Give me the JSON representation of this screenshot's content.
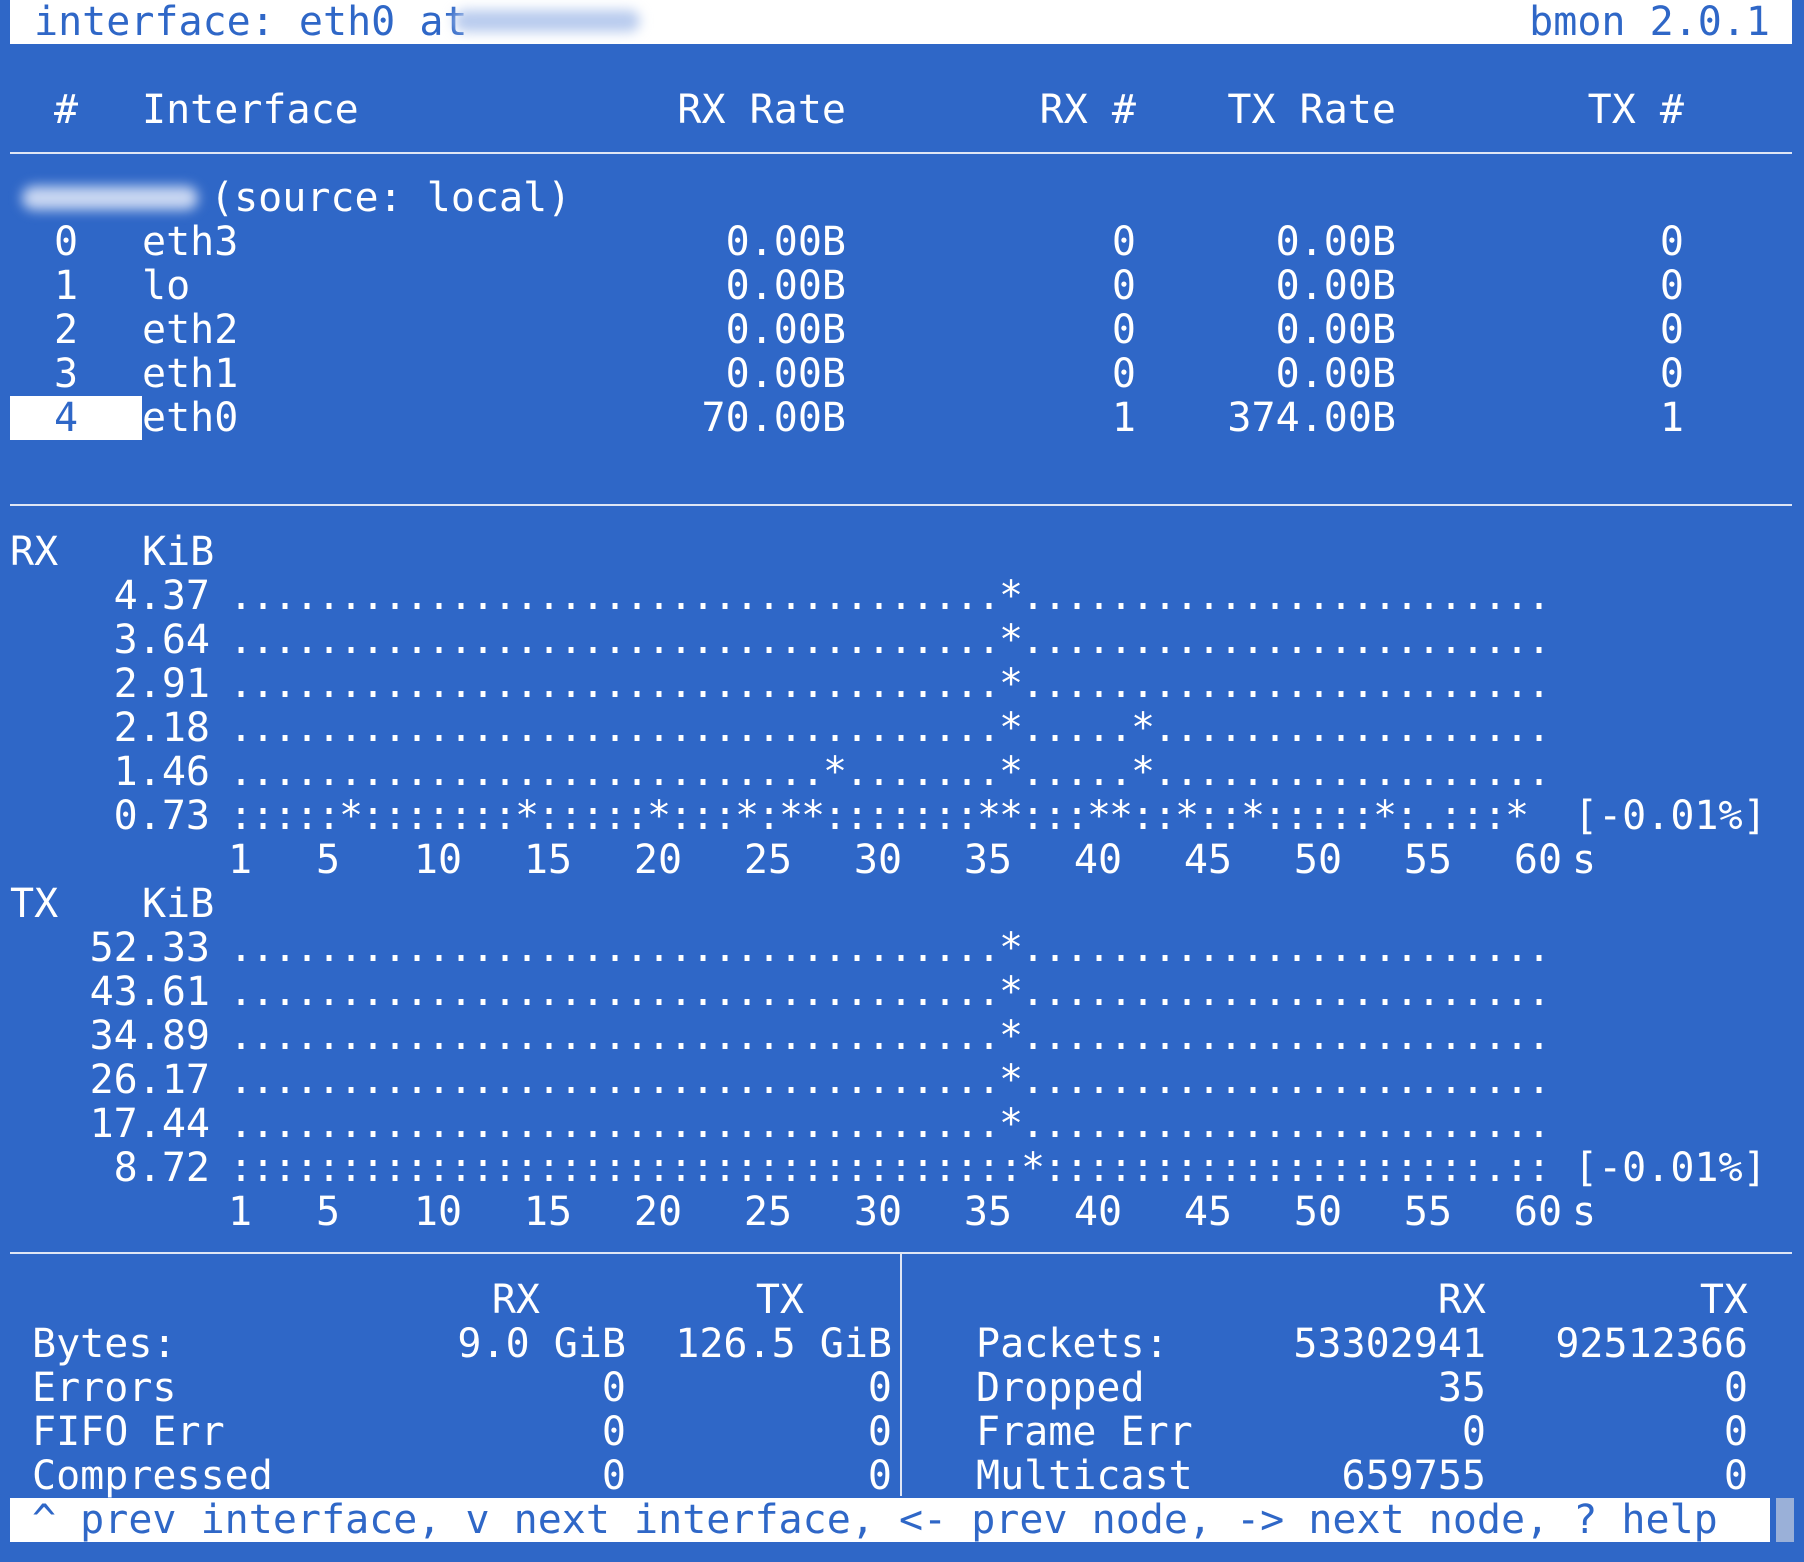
{
  "header": {
    "prefix": "interface: eth0 at",
    "version": "bmon 2.0.1"
  },
  "table": {
    "columns": {
      "num": "#",
      "interface": "Interface",
      "rx_rate": "RX Rate",
      "rx_count": "RX #",
      "tx_rate": "TX Rate",
      "tx_count": "TX #"
    },
    "source": "(source: local)",
    "rows": [
      {
        "num": "0",
        "name": "eth3",
        "rx_rate": "0.00B",
        "rx_count": "0",
        "tx_rate": "0.00B",
        "tx_count": "0"
      },
      {
        "num": "1",
        "name": "lo",
        "rx_rate": "0.00B",
        "rx_count": "0",
        "tx_rate": "0.00B",
        "tx_count": "0"
      },
      {
        "num": "2",
        "name": "eth2",
        "rx_rate": "0.00B",
        "rx_count": "0",
        "tx_rate": "0.00B",
        "tx_count": "0"
      },
      {
        "num": "3",
        "name": "eth1",
        "rx_rate": "0.00B",
        "rx_count": "0",
        "tx_rate": "0.00B",
        "tx_count": "0"
      },
      {
        "num": "4",
        "name": "eth0",
        "rx_rate": "70.00B",
        "rx_count": "1",
        "tx_rate": "374.00B",
        "tx_count": "1"
      }
    ],
    "selected_index": 4
  },
  "graphs": {
    "rx": {
      "label": "RX",
      "unit": "KiB",
      "y_labels": [
        "4.37",
        "3.64",
        "2.91",
        "2.18",
        "1.46",
        "0.73"
      ],
      "rows": [
        "...................................*........................",
        "...................................*........................",
        "...................................*........................",
        "...................................*.....*..................",
        "...........................*.......*.....*..................",
        ":::::*:::::::*:::::*:::*:**:::::::**:::**::*::*:::::*:.:::*"
      ],
      "percent": "[-0.01%]",
      "x_ticks": [
        "1",
        "5",
        "10",
        "15",
        "20",
        "25",
        "30",
        "35",
        "40",
        "45",
        "50",
        "55",
        "60"
      ],
      "x_unit": "s"
    },
    "tx": {
      "label": "TX",
      "unit": "KiB",
      "y_labels": [
        "52.33",
        "43.61",
        "34.89",
        "26.17",
        "17.44",
        "8.72"
      ],
      "rows": [
        "...................................*........................",
        "...................................*........................",
        "...................................*........................",
        "...................................*........................",
        "...................................*........................",
        "::::::::::::::::::::::::::::::::::::*::::::::::::::::::::.::.:"
      ],
      "percent": "[-0.01%]",
      "x_ticks": [
        "1",
        "5",
        "10",
        "15",
        "20",
        "25",
        "30",
        "35",
        "40",
        "45",
        "50",
        "55",
        "60"
      ],
      "x_unit": "s"
    }
  },
  "stats_left": {
    "col_rx": "RX",
    "col_tx": "TX",
    "rows": [
      {
        "label": "Bytes:",
        "rx": "9.0 GiB",
        "tx": "126.5 GiB"
      },
      {
        "label": "Errors",
        "rx": "0",
        "tx": "0"
      },
      {
        "label": "FIFO Err",
        "rx": "0",
        "tx": "0"
      },
      {
        "label": "Compressed",
        "rx": "0",
        "tx": "0"
      }
    ]
  },
  "stats_right": {
    "col_rx": "RX",
    "col_tx": "TX",
    "rows": [
      {
        "label": "Packets:",
        "rx": "53302941",
        "tx": "92512366"
      },
      {
        "label": "Dropped",
        "rx": "35",
        "tx": "0"
      },
      {
        "label": "Frame Err",
        "rx": "0",
        "tx": "0"
      },
      {
        "label": "Multicast",
        "rx": "659755",
        "tx": "0"
      }
    ]
  },
  "footer": {
    "help": "^ prev interface, v next interface, <- prev node, -> next node, ? help"
  },
  "colors": {
    "background": "#2f67c7",
    "foreground": "#ffffff"
  }
}
